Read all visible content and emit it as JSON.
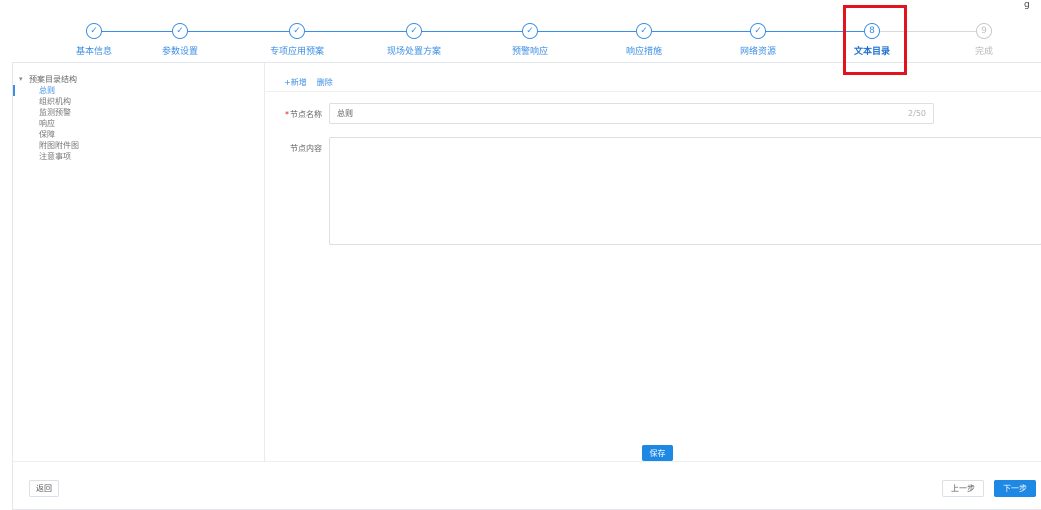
{
  "stepper": {
    "steps": [
      {
        "label": "基本信息",
        "state": "done",
        "icon": "check-icon"
      },
      {
        "label": "参数设置",
        "state": "done",
        "icon": "check-icon"
      },
      {
        "label": "专项应用预案",
        "state": "done",
        "icon": "check-icon"
      },
      {
        "label": "现场处置方案",
        "state": "done",
        "icon": "check-icon"
      },
      {
        "label": "预警响应",
        "state": "done",
        "icon": "check-icon"
      },
      {
        "label": "响应措施",
        "state": "done",
        "icon": "check-icon"
      },
      {
        "label": "网络资源",
        "state": "done",
        "icon": "check-icon"
      },
      {
        "label": "文本目录",
        "state": "active",
        "number": "8"
      },
      {
        "label": "完成",
        "state": "todo",
        "number": "9"
      }
    ],
    "highlight_color": "#e0141e",
    "accent_color": "#3a8ee6",
    "corner_mark": "g"
  },
  "sidebar": {
    "root_label": "预案目录结构",
    "items": [
      "总则",
      "组织机构",
      "监测预警",
      "响应",
      "保障",
      "附图附件图",
      "注意事项"
    ],
    "selected_index": 0
  },
  "toolbar": {
    "add_label": "+新增",
    "delete_label": "删除"
  },
  "form": {
    "title_label": "节点名称",
    "title_value": "总则",
    "title_counter": "2/50",
    "content_label": "节点内容",
    "content_value": ""
  },
  "actions": {
    "save_label": "保存",
    "back_label": "返回",
    "prev_label": "上一步",
    "next_label": "下一步"
  }
}
